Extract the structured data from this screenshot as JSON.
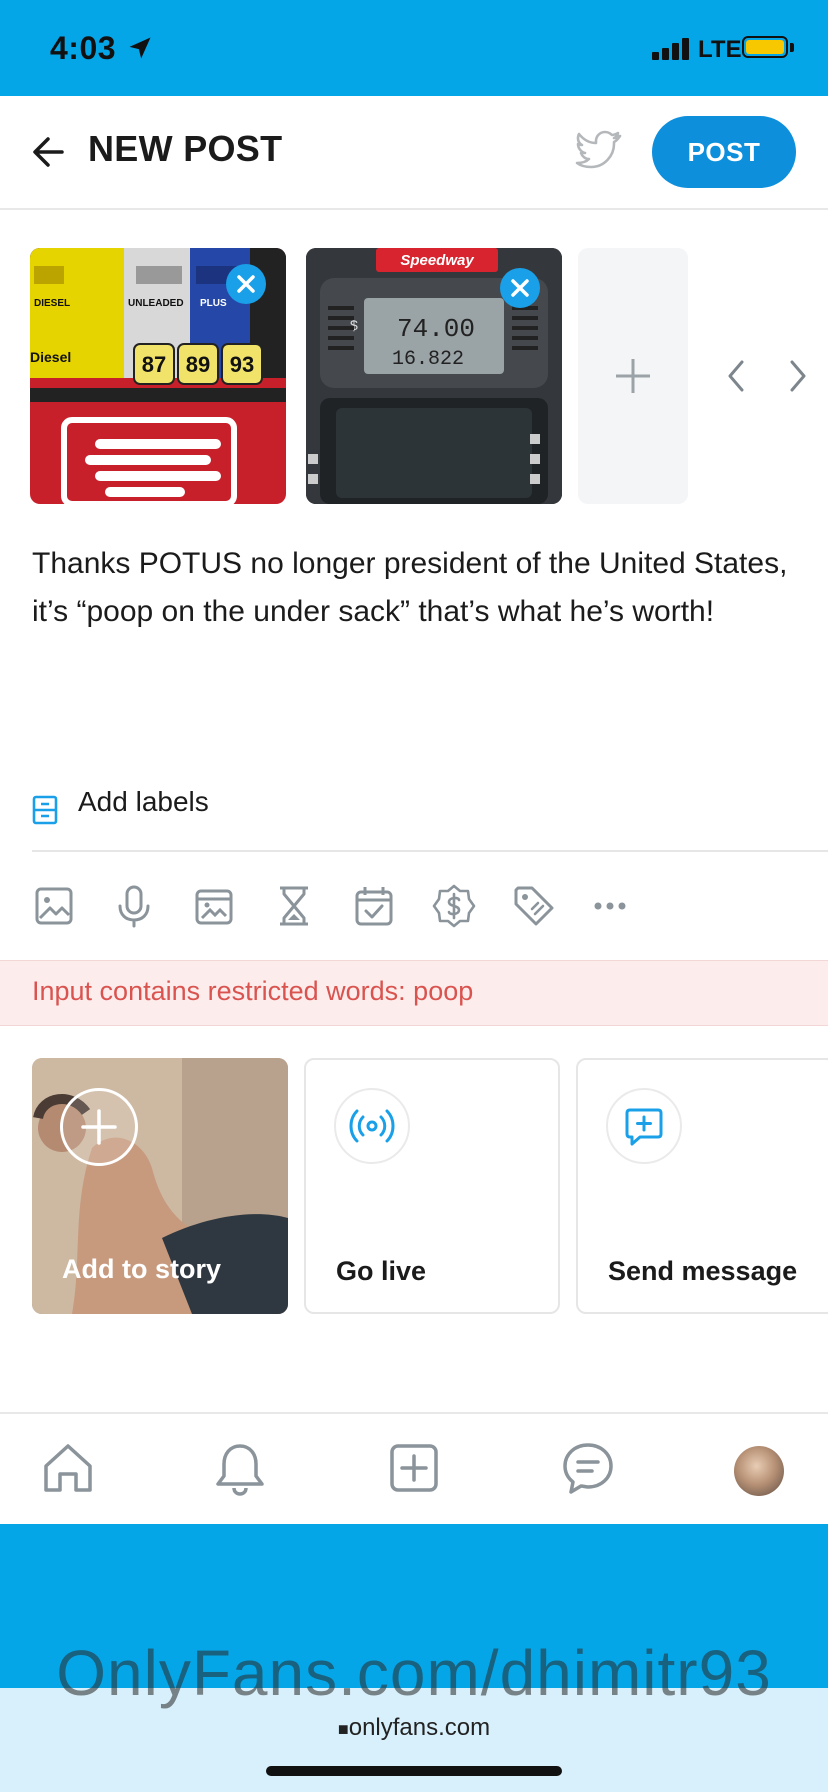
{
  "status_bar": {
    "time": "4:03",
    "network": "LTE"
  },
  "header": {
    "title": "NEW POST",
    "post_label": "POST"
  },
  "media": [
    {
      "name": "gas-pump-photo",
      "grades": [
        "87",
        "89",
        "93"
      ],
      "labels": [
        "DIESEL",
        "UNLEADED",
        "PLUS",
        "Diesel"
      ]
    },
    {
      "name": "speedway-pump-photo",
      "brand": "Speedway",
      "amount": "74.00",
      "gallons": "16.822"
    }
  ],
  "post": {
    "text": "Thanks POTUS no longer president of the United States, it’s “poop on the under sack” that’s what he’s worth!"
  },
  "labels": {
    "text": "Add labels"
  },
  "warning": {
    "text": "Input contains restricted words: poop"
  },
  "cards": {
    "story": "Add to story",
    "live": "Go live",
    "message": "Send message"
  },
  "footer": {
    "url": "onlyfans.com",
    "watermark": "OnlyFans.com/dhimitr93"
  },
  "colors": {
    "accent": "#0d8fdc",
    "status_blue": "#05a6e8",
    "warning": "#d9534f"
  }
}
